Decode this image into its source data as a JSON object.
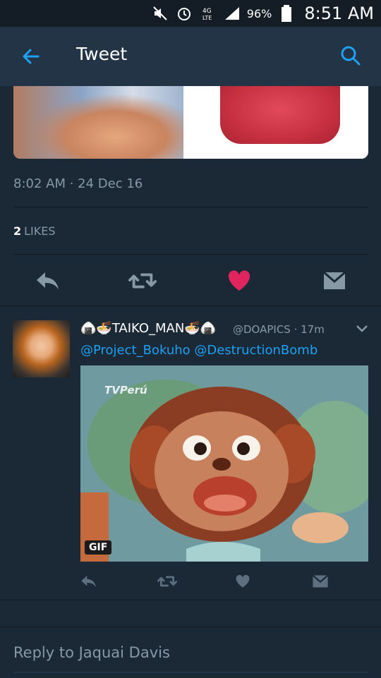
{
  "status_bar": {
    "battery": "96%",
    "time": "8:51 AM",
    "network": "4G"
  },
  "app_bar": {
    "title": "Tweet",
    "back_icon": "arrow-left-icon",
    "search_icon": "search-icon"
  },
  "tweet": {
    "timestamp": "8:02 AM · 24 Dec 16",
    "likes_count": "2",
    "likes_label": "LIKES",
    "liked": true,
    "like_color": "#e0245e"
  },
  "reply": {
    "author": "🍙🍜TAIKO_MAN🍜🍙",
    "handle": "@DOAPICS · 17m",
    "mentions": "@Project_Bokuho @DestructionBomb",
    "gif_badge": "GIF",
    "gif_watermark": "TVPerú"
  },
  "compose": {
    "placeholder": "Reply to Jaquai Davis"
  },
  "colors": {
    "background": "#1b2836",
    "appbar": "#243447",
    "accent": "#1da1f2",
    "muted": "#8899a6"
  }
}
